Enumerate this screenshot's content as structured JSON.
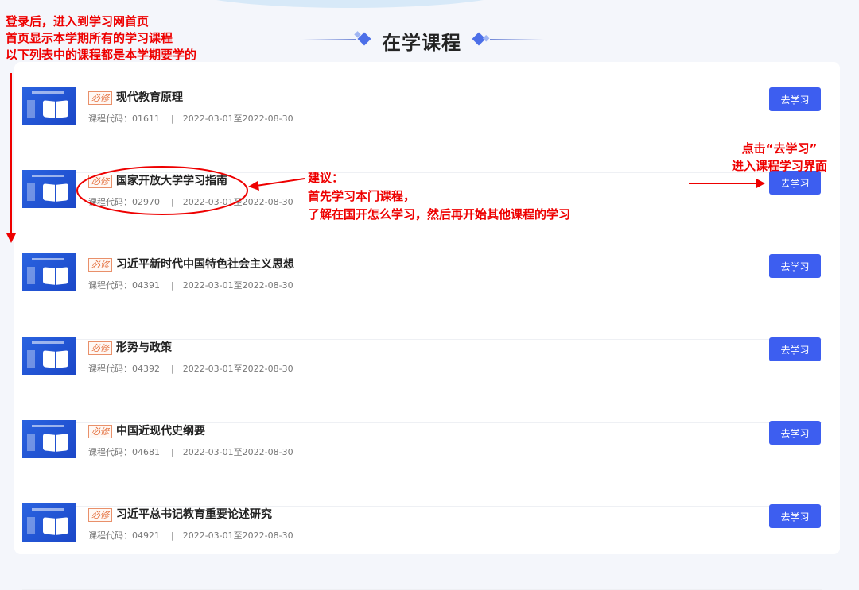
{
  "heading": {
    "title": "在学课程"
  },
  "courses": [
    {
      "tag": "必修",
      "title": "现代教育原理",
      "code_label": "课程代码：01611",
      "period": "2022-03-01至2022-08-30",
      "button": "去学习"
    },
    {
      "tag": "必修",
      "title": "国家开放大学学习指南",
      "code_label": "课程代码：02970",
      "period": "2022-03-01至2022-08-30",
      "button": "去学习"
    },
    {
      "tag": "必修",
      "title": "习近平新时代中国特色社会主义思想",
      "code_label": "课程代码：04391",
      "period": "2022-03-01至2022-08-30",
      "button": "去学习"
    },
    {
      "tag": "必修",
      "title": "形势与政策",
      "code_label": "课程代码：04392",
      "period": "2022-03-01至2022-08-30",
      "button": "去学习"
    },
    {
      "tag": "必修",
      "title": "中国近现代史纲要",
      "code_label": "课程代码：04681",
      "period": "2022-03-01至2022-08-30",
      "button": "去学习"
    },
    {
      "tag": "必修",
      "title": "习近平总书记教育重要论述研究",
      "code_label": "课程代码：04921",
      "period": "2022-03-01至2022-08-30",
      "button": "去学习"
    }
  ],
  "separator": "|",
  "annotations": {
    "left": [
      "登录后，进入到学习网首页",
      "首页显示本学期所有的学习课程",
      "以下列表中的课程都是本学期要学的"
    ],
    "middle": [
      "建议：",
      "首先学习本门课程，",
      "了解在国开怎么学习，然后再开始其他课程的学习"
    ],
    "right": [
      "点击“去学习”",
      "进入课程学习界面"
    ],
    "color": "#e00000"
  },
  "colors": {
    "accent": "#3d5ef0",
    "tag": "#e36d3a"
  },
  "icons": {
    "thumbnail": "open-book-icon",
    "heading_decoration": "diamond-icon"
  }
}
